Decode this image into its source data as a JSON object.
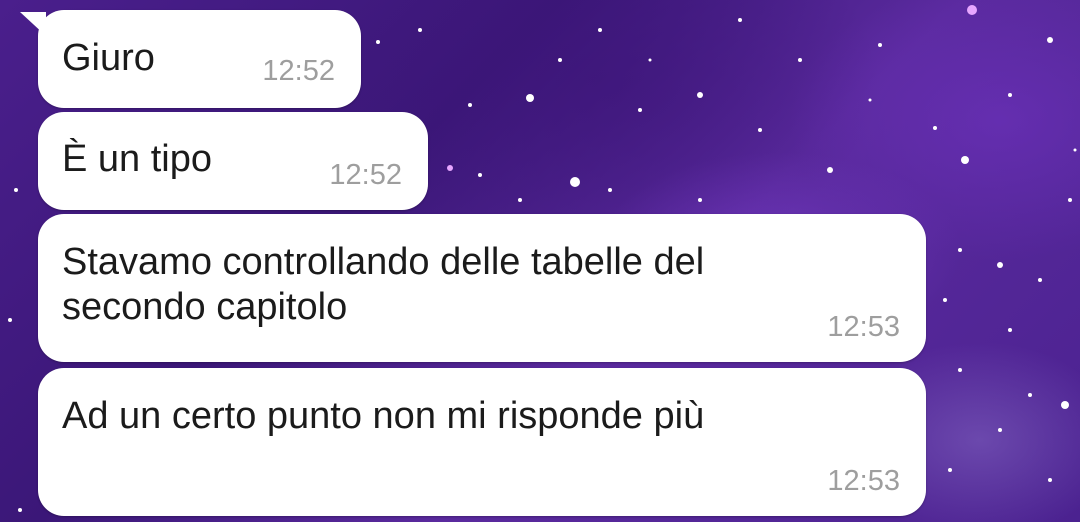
{
  "messages": [
    {
      "text": "Giuro",
      "time": "12:52"
    },
    {
      "text": "È un tipo",
      "time": "12:52"
    },
    {
      "text": "Stavamo controllando delle tabelle del\nsecondo capitolo",
      "time": "12:53"
    },
    {
      "text": "Ad un certo punto non mi risponde più",
      "time": "12:53"
    }
  ],
  "colors": {
    "bubble": "#ffffff",
    "text": "#1b1b1b",
    "time": "#9e9e9e",
    "wallpaper": "#4a1f8c"
  }
}
